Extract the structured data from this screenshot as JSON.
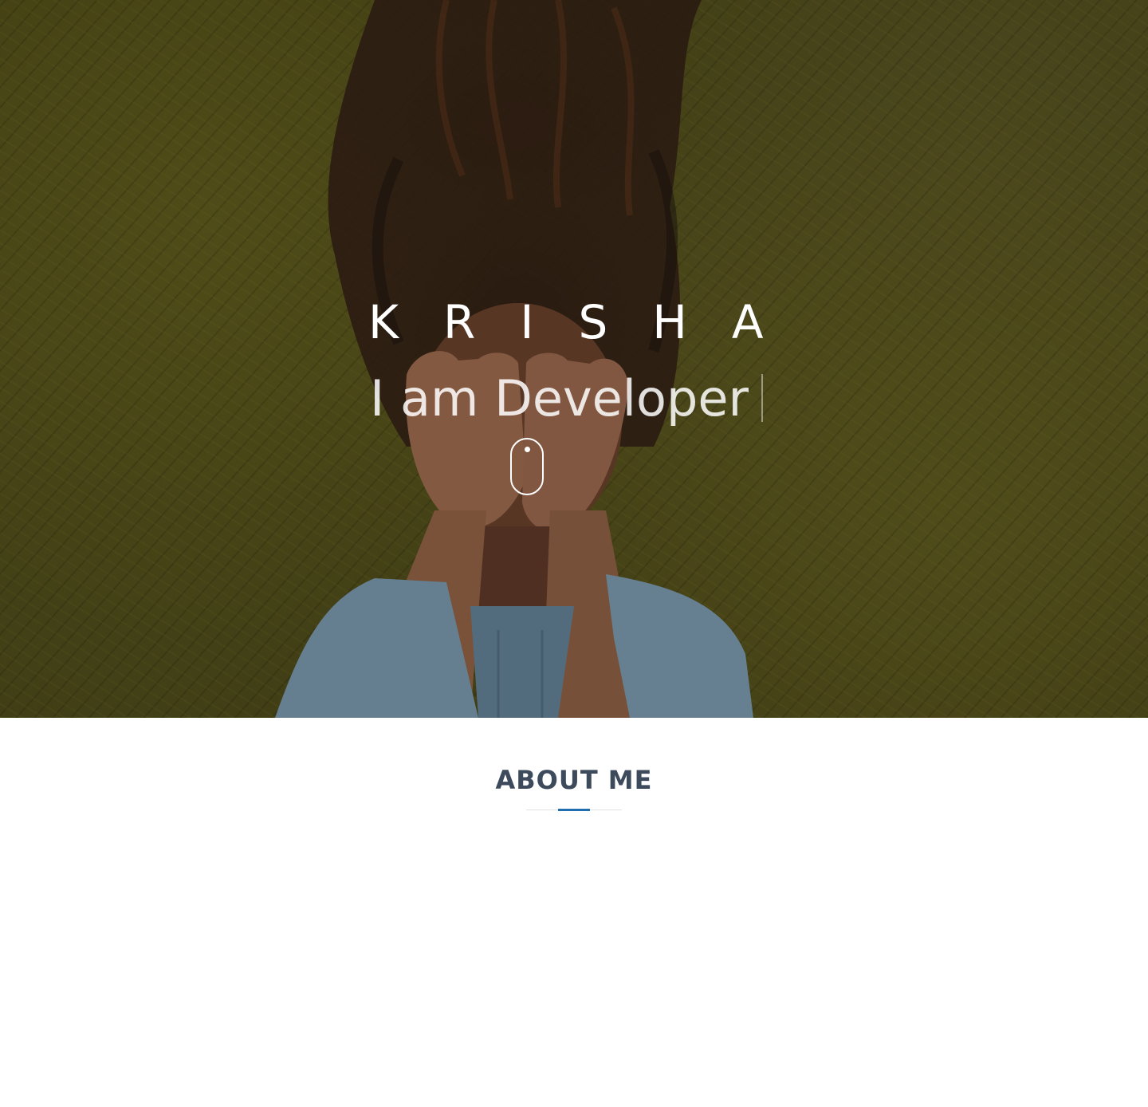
{
  "hero": {
    "name": "KRISHA",
    "tagline": "I am Developer",
    "scroll_icon": "mouse-scroll-icon",
    "overlay_color": "#000000"
  },
  "about": {
    "title": "ABOUT ME",
    "title_color": "#3d4a5c",
    "accent_color": "#1f6eb0"
  }
}
